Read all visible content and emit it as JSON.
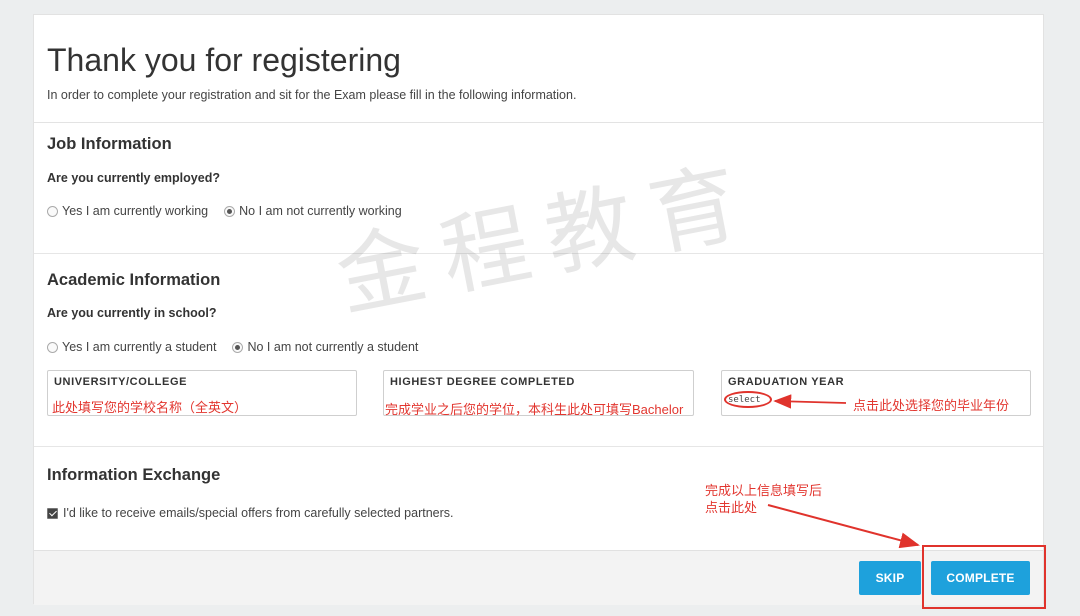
{
  "header": {
    "title": "Thank you for registering",
    "subtitle": "In order to complete your registration and sit for the Exam please fill in the following information."
  },
  "job": {
    "section_title": "Job Information",
    "question": "Are you currently employed?",
    "options": [
      {
        "label": "Yes I am currently working",
        "checked": false
      },
      {
        "label": "No I am not currently working",
        "checked": true
      }
    ]
  },
  "academic": {
    "section_title": "Academic Information",
    "question": "Are you currently in school?",
    "options": [
      {
        "label": "Yes I am currently a student",
        "checked": false
      },
      {
        "label": "No I am not currently a student",
        "checked": true
      }
    ],
    "fields": [
      {
        "label": "UNIVERSITY/COLLEGE",
        "note": "此处填写您的学校名称（全英文）"
      },
      {
        "label": "HIGHEST DEGREE COMPLETED",
        "note": "完成学业之后您的学位，本科生此处可填写Bachelor"
      },
      {
        "label": "GRADUATION YEAR",
        "select_value": "select",
        "note": "点击此处选择您的毕业年份"
      }
    ]
  },
  "exchange": {
    "section_title": "Information Exchange",
    "checkbox_label": "I'd like to receive emails/special offers from carefully selected partners.",
    "checked": true
  },
  "annotation": {
    "line1": "完成以上信息填写后",
    "line2": "点击此处"
  },
  "footer": {
    "skip_label": "SKIP",
    "complete_label": "COMPLETE"
  },
  "watermark": "金程教育",
  "colors": {
    "primary_button": "#1ea1dc",
    "annotation_red": "#e0332c"
  }
}
